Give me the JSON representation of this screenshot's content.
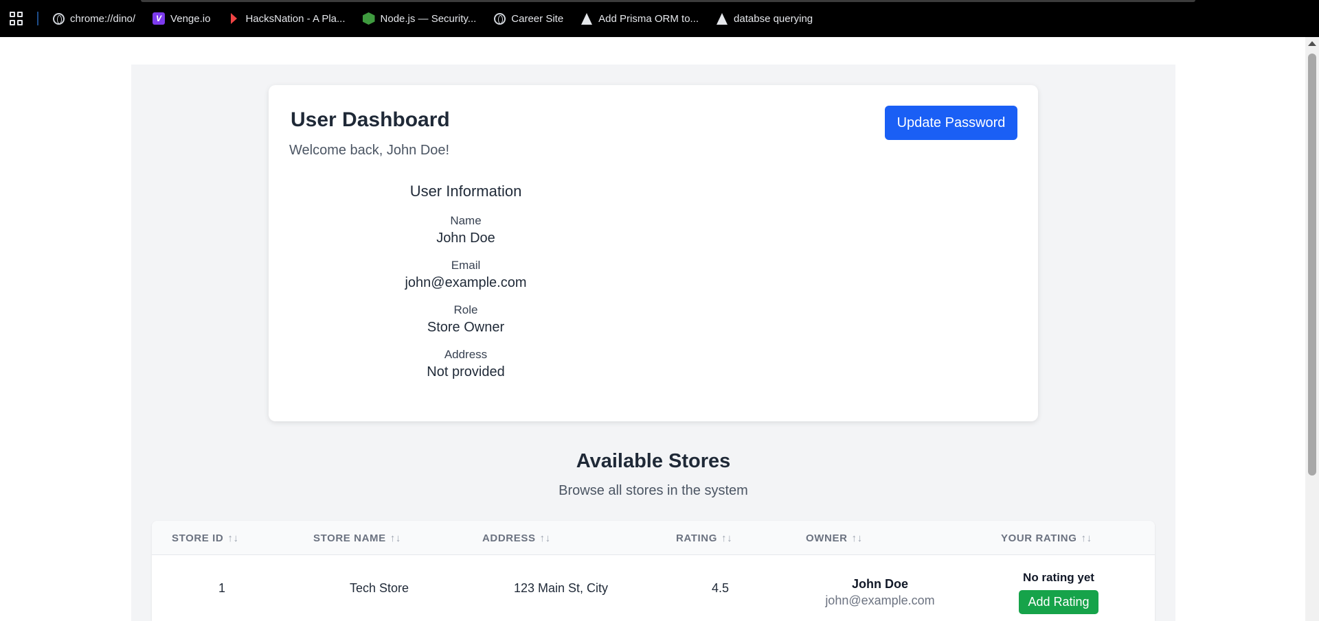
{
  "bookmarks": [
    {
      "label": "chrome://dino/",
      "icon": "globe-icon"
    },
    {
      "label": "Venge.io",
      "icon": "venge-icon"
    },
    {
      "label": "HacksNation - A Pla...",
      "icon": "hacksnation-icon"
    },
    {
      "label": "Node.js — Security...",
      "icon": "nodejs-icon"
    },
    {
      "label": "Career Site",
      "icon": "globe-icon"
    },
    {
      "label": "Add Prisma ORM to...",
      "icon": "prisma-icon"
    },
    {
      "label": "databse querying",
      "icon": "prisma-icon"
    }
  ],
  "dashboard": {
    "title": "User Dashboard",
    "welcome": "Welcome back, John Doe!",
    "update_password_label": "Update Password",
    "info_heading": "User Information",
    "fields": [
      {
        "label": "Name",
        "value": "John Doe"
      },
      {
        "label": "Email",
        "value": "john@example.com"
      },
      {
        "label": "Role",
        "value": "Store Owner"
      },
      {
        "label": "Address",
        "value": "Not provided"
      }
    ]
  },
  "stores": {
    "title": "Available Stores",
    "subtitle": "Browse all stores in the system",
    "columns": [
      "STORE ID",
      "STORE NAME",
      "ADDRESS",
      "RATING",
      "OWNER",
      "YOUR RATING"
    ],
    "sort_glyph": "↑↓",
    "rows": [
      {
        "id": "1",
        "name": "Tech Store",
        "address": "123 Main St, City",
        "rating": "4.5",
        "owner_name": "John Doe",
        "owner_email": "john@example.com",
        "your_rating": "No rating yet",
        "action_label": "Add Rating"
      }
    ]
  },
  "colors": {
    "primary_button": "#1a5ff5",
    "success_button": "#16a34a",
    "page_background": "#f3f4f6"
  }
}
